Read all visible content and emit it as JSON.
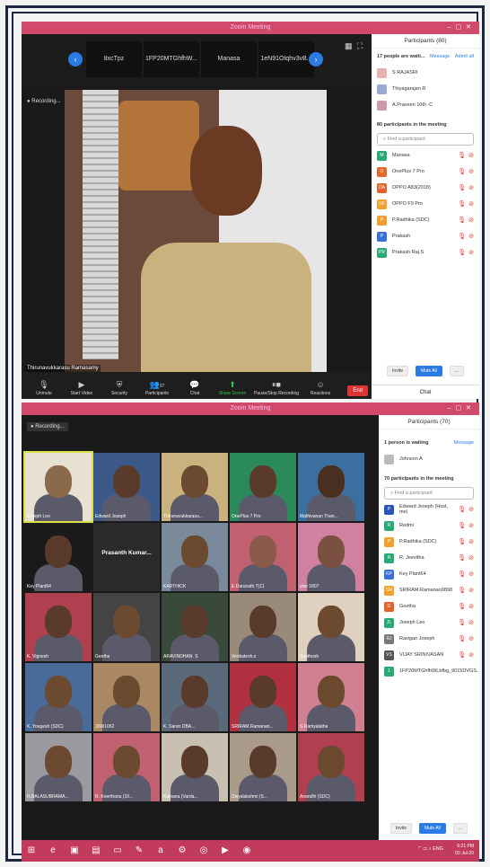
{
  "window1": {
    "title": "Zoom Meeting",
    "strip": [
      "8xcTpz",
      "1FP20MTGhfhW...",
      "Manasa",
      "1eN91Otqhv3vB..."
    ],
    "recording": "Recording...",
    "speaker": "Thirunavukkarasu Ramasamy",
    "toolbar": [
      "Unmute",
      "Start Video",
      "Security",
      "Participants",
      "Chat",
      "Share Screen",
      "Pause/Stop Recording",
      "Reactions"
    ],
    "participants_count": "97",
    "end": "End",
    "panel": {
      "title": "Participants (80)",
      "waiting": "17 people are waiti...",
      "message": "Message",
      "admit_all": "Admit all",
      "waiting_list": [
        "S RAJASRI",
        "Thiyagarajan R",
        "A.Praveen 10th -C"
      ],
      "in_meeting": "80 participants in the meeting",
      "find": "Find a participant",
      "participants": [
        {
          "name": "Manasa",
          "initial": "M",
          "color": "#2aa876"
        },
        {
          "name": "OnePlus 7 Pro",
          "initial": "O",
          "color": "#e06b2c"
        },
        {
          "name": "OPPO A83(2018)",
          "initial": "OA",
          "color": "#e0642c"
        },
        {
          "name": "OPPO F9 Pro",
          "initial": "OF",
          "color": "#f0a030"
        },
        {
          "name": "P.Radhika (SDC)",
          "initial": "P",
          "color": "#f0a030"
        },
        {
          "name": "Prakash",
          "initial": "P",
          "color": "#3a6fd8"
        },
        {
          "name": "Prakash Raj.S",
          "initial": "PR",
          "color": "#2aa876"
        }
      ],
      "invite": "Invite",
      "mute_all": "Mute All",
      "more": "...",
      "chat": "Chat"
    }
  },
  "window2": {
    "title": "Zoom Meeting",
    "recording": "Recording...",
    "tiles": [
      "Joseph Leo",
      "Edward Joseph",
      "Thirunavukkarasu...",
      "OnePlus 7 Pro",
      "Mathivanan Than...",
      "Key Plant64",
      "Prasanth  Kumar...",
      "KARTHICK",
      "E.Darunath.T(11",
      "vivo 1807",
      "K. Vignesh",
      "Geetha",
      "ARAVINDHAN. S",
      "Venkatesh.s",
      "Santhosh",
      "K. Yougesh (SDC)",
      "39W1062",
      "K. Saran DBA...",
      "SRIRAM.Ramanan...",
      "S.Ramyalatha",
      "R.BALASUBRAMA...",
      "R. Keerthana (10...",
      "Kalpana (Varda...",
      "Divyalakshmi (S...",
      "Anandhi (SDC)"
    ],
    "panel": {
      "title": "Participants (70)",
      "waiting": "1 person is waiting",
      "message": "Message",
      "waiting_list": [
        "Johnson A"
      ],
      "in_meeting": "70 participants in the meeting",
      "find": "Find a participant",
      "participants": [
        {
          "name": "Edward Joseph (Host, me)",
          "initial": "P",
          "color": "#2a55b8"
        },
        {
          "name": "Redmi",
          "initial": "R",
          "color": "#2aa876"
        },
        {
          "name": "P.Radhika (SDC)",
          "initial": "P",
          "color": "#f0a030"
        },
        {
          "name": "R. Jeevitha",
          "initial": "R",
          "color": "#2aa876"
        },
        {
          "name": "Key Plant64",
          "initial": "KP",
          "color": "#3a6fd8"
        },
        {
          "name": "SRIRAM.Ramanan9898",
          "initial": "SR",
          "color": "#f0a030"
        },
        {
          "name": "Geetha",
          "initial": "G",
          "color": "#e0642c"
        },
        {
          "name": "Joseph Leo",
          "initial": "JL",
          "color": "#2aa876"
        },
        {
          "name": "Ravigan Joseph",
          "initial": "RJ",
          "color": "#777777"
        },
        {
          "name": "VIJAY SRINIVASAN",
          "initial": "VS",
          "color": "#555555"
        },
        {
          "name": "1FP20MTGhfhWLbfbg_9015DVGS...",
          "initial": "1",
          "color": "#2aa876"
        }
      ],
      "invite": "Invite",
      "mute_all": "Mute All",
      "more": "..."
    }
  },
  "taskbar": {
    "time": "6:21 PM",
    "date": "02-Jul-20",
    "lang": "ENG"
  }
}
